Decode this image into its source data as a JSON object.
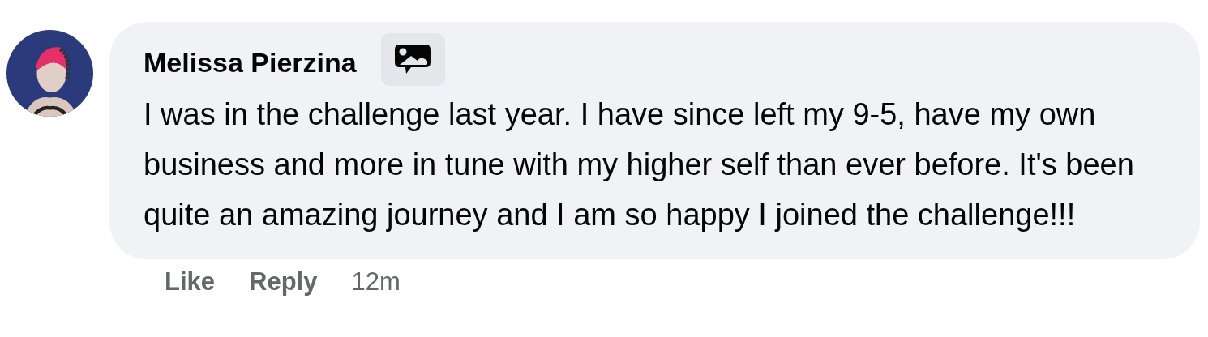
{
  "comment": {
    "author": "Melissa Pierzina",
    "text": "I was in the challenge last year. I have since left my 9-5, have my own business and more in tune with my higher self than ever before. It's been quite an amazing journey and I am so happy I joined the challenge!!!",
    "actions": [
      {
        "kind": "link",
        "label": "Like"
      },
      {
        "kind": "link",
        "label": "Reply"
      },
      {
        "kind": "time",
        "label": "12m"
      }
    ]
  }
}
